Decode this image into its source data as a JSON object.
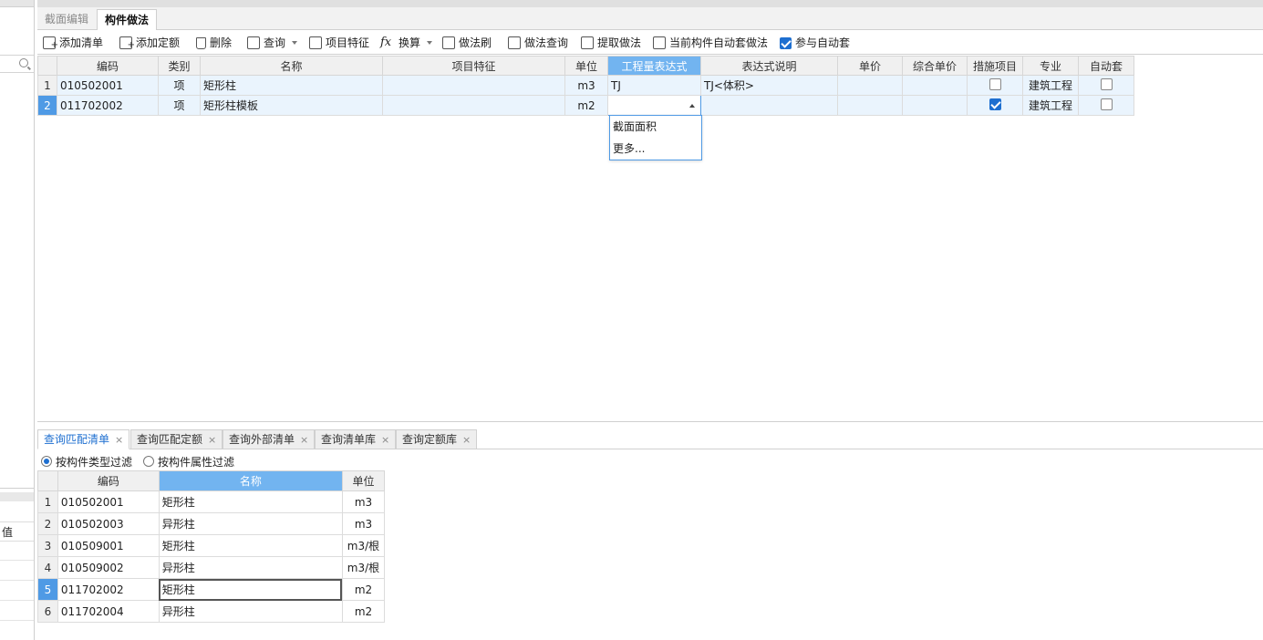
{
  "left": {
    "value_label": "值"
  },
  "top_tabs": [
    {
      "label": "截面编辑",
      "active": false
    },
    {
      "label": "构件做法",
      "active": true
    }
  ],
  "toolbar": {
    "add_list": "添加清单",
    "add_quota": "添加定额",
    "delete": "删除",
    "query": "查询",
    "item_feature": "项目特征",
    "convert": "换算",
    "method_brush": "做法刷",
    "method_query": "做法查询",
    "extract_method": "提取做法",
    "current_auto": "当前构件自动套做法",
    "join_auto": "参与自动套",
    "join_auto_checked": true
  },
  "grid1": {
    "headers": [
      "编码",
      "类别",
      "名称",
      "项目特征",
      "单位",
      "工程量表达式",
      "表达式说明",
      "单价",
      "综合单价",
      "措施项目",
      "专业",
      "自动套"
    ],
    "rows": [
      {
        "no": "1",
        "code": "010502001",
        "type": "项",
        "name": "矩形柱",
        "feature": "",
        "unit": "m3",
        "expr": "TJ",
        "expr_desc": "TJ<体积>",
        "price": "",
        "comp_price": "",
        "measure": false,
        "major": "建筑工程",
        "auto": false
      },
      {
        "no": "2",
        "code": "011702002",
        "type": "项",
        "name": "矩形柱模板",
        "feature": "",
        "unit": "m2",
        "expr": "",
        "expr_desc": "",
        "price": "",
        "comp_price": "",
        "measure": true,
        "major": "建筑工程",
        "auto": false
      }
    ]
  },
  "dropdown": {
    "options": [
      "截面面积",
      "更多..."
    ]
  },
  "bottom_tabs": [
    {
      "label": "查询匹配清单",
      "active": true
    },
    {
      "label": "查询匹配定额",
      "active": false
    },
    {
      "label": "查询外部清单",
      "active": false
    },
    {
      "label": "查询清单库",
      "active": false
    },
    {
      "label": "查询定额库",
      "active": false
    }
  ],
  "filters": {
    "by_type": "按构件类型过滤",
    "by_attr": "按构件属性过滤",
    "selected": "by_type"
  },
  "grid2": {
    "headers": [
      "编码",
      "名称",
      "单位"
    ],
    "rows": [
      {
        "no": "1",
        "code": "010502001",
        "name": "矩形柱",
        "unit": "m3"
      },
      {
        "no": "2",
        "code": "010502003",
        "name": "异形柱",
        "unit": "m3"
      },
      {
        "no": "3",
        "code": "010509001",
        "name": "矩形柱",
        "unit": "m3/根"
      },
      {
        "no": "4",
        "code": "010509002",
        "name": "异形柱",
        "unit": "m3/根"
      },
      {
        "no": "5",
        "code": "011702002",
        "name": "矩形柱",
        "unit": "m2"
      },
      {
        "no": "6",
        "code": "011702004",
        "name": "异形柱",
        "unit": "m2"
      }
    ]
  }
}
